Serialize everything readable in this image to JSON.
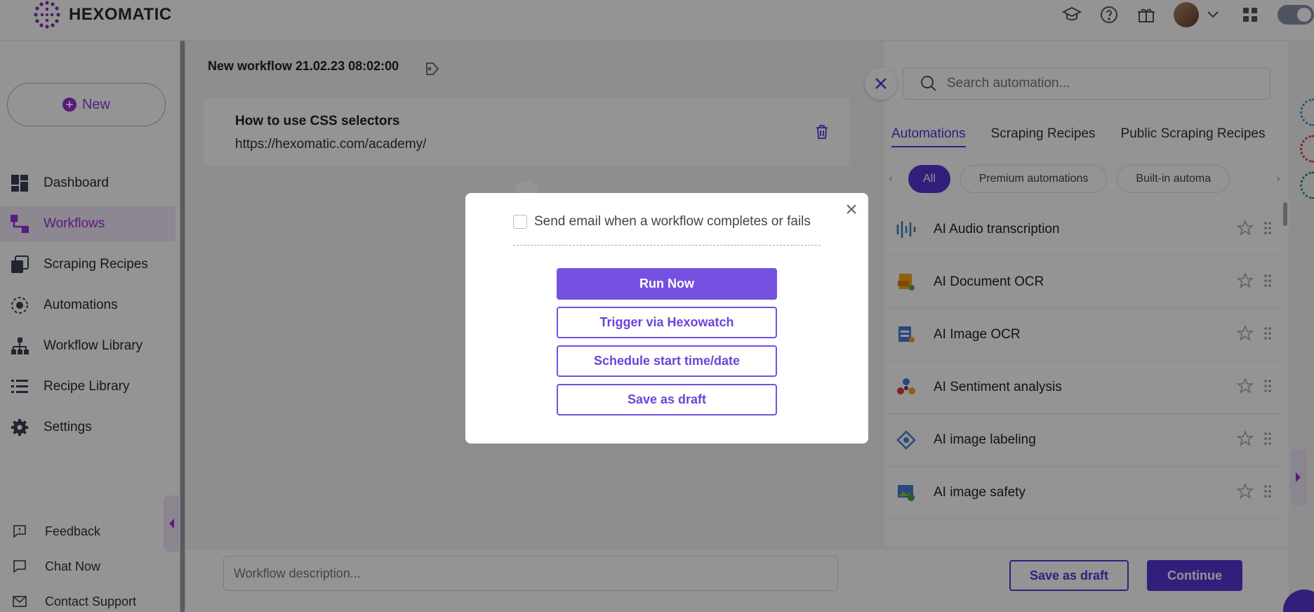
{
  "app": {
    "brand": "HEXOMATIC"
  },
  "sidebar": {
    "new_label": "New",
    "items": [
      {
        "label": "Dashboard",
        "icon": "dashboard-icon"
      },
      {
        "label": "Workflows",
        "icon": "workflow-icon",
        "active": true
      },
      {
        "label": "Scraping Recipes",
        "icon": "recipes-icon"
      },
      {
        "label": "Automations",
        "icon": "automation-icon"
      },
      {
        "label": "Workflow Library",
        "icon": "library-icon"
      },
      {
        "label": "Recipe Library",
        "icon": "list-icon"
      },
      {
        "label": "Settings",
        "icon": "gear-icon"
      }
    ],
    "footer": [
      {
        "label": "Feedback",
        "icon": "feedback-icon"
      },
      {
        "label": "Chat Now",
        "icon": "chat-icon"
      },
      {
        "label": "Contact Support",
        "icon": "mail-icon"
      }
    ]
  },
  "workflow": {
    "title": "New workflow 21.02.23 08:02:00",
    "step": {
      "title": "How to use CSS selectors",
      "url": "https://hexomatic.com/academy/"
    },
    "description_placeholder": "Workflow description..."
  },
  "panel": {
    "search_placeholder": "Search automation...",
    "tabs": [
      "Automations",
      "Scraping Recipes",
      "Public Scraping Recipes"
    ],
    "chips": [
      "All",
      "Premium automations",
      "Built-in automa"
    ],
    "automations": [
      {
        "name": "AI Audio transcription",
        "icon": "audio-wave-icon"
      },
      {
        "name": "AI Document OCR",
        "icon": "document-pdf-icon"
      },
      {
        "name": "AI Image OCR",
        "icon": "image-document-icon"
      },
      {
        "name": "AI Sentiment analysis",
        "icon": "sentiment-icon"
      },
      {
        "name": "AI image labeling",
        "icon": "label-diamond-icon"
      },
      {
        "name": "AI image safety",
        "icon": "image-safety-icon"
      }
    ]
  },
  "footer_actions": {
    "save_draft": "Save as draft",
    "continue": "Continue"
  },
  "modal": {
    "email_label": "Send email when a workflow completes or fails",
    "email_checked": false,
    "run_now": "Run Now",
    "trigger": "Trigger via Hexowatch",
    "schedule": "Schedule start time/date",
    "save_draft": "Save as draft"
  },
  "colors": {
    "accent": "#5b34d6",
    "brand_purple": "#9b30d9"
  }
}
